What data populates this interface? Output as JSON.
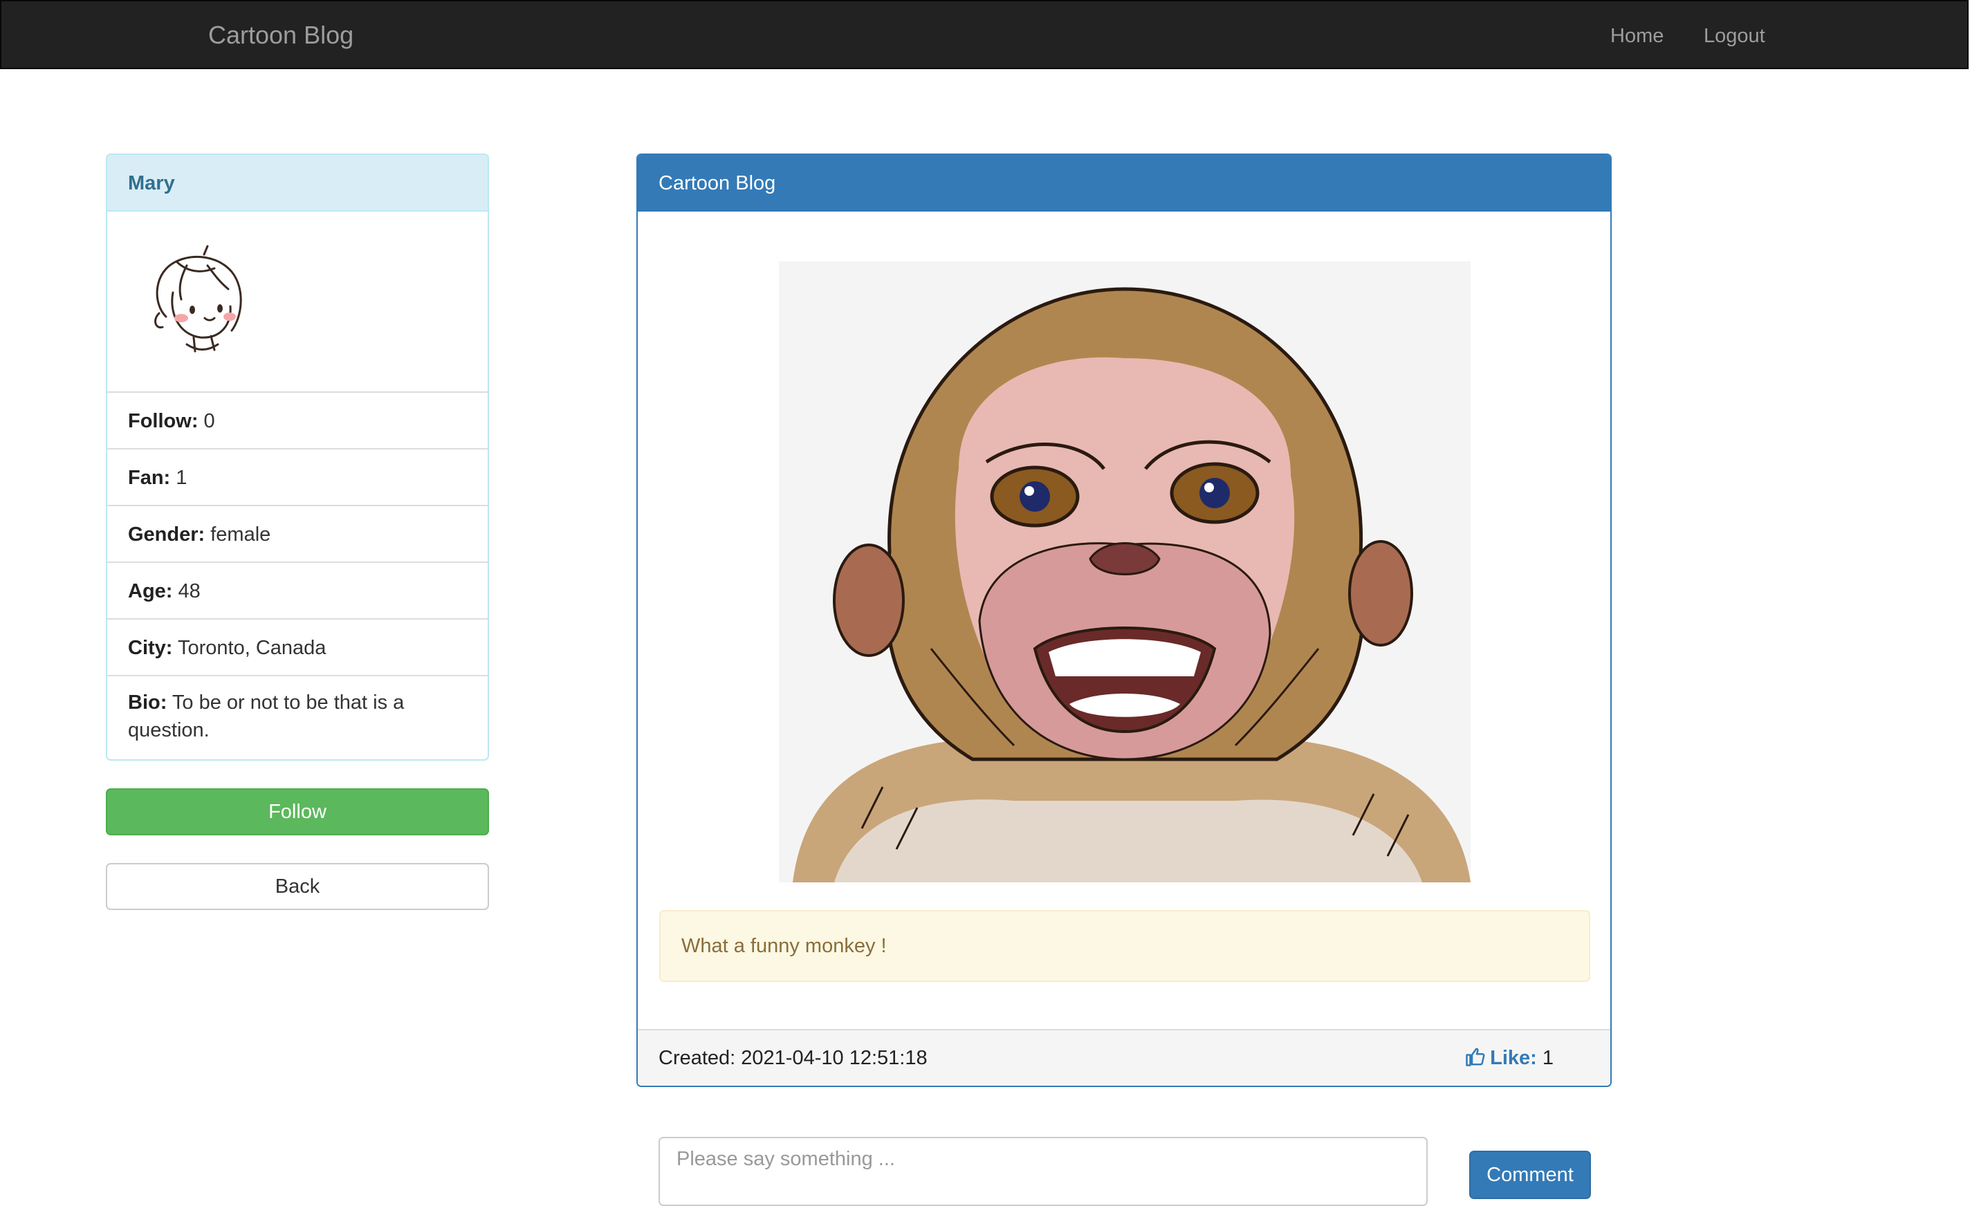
{
  "navbar": {
    "brand": "Cartoon Blog",
    "links": {
      "home": "Home",
      "logout": "Logout"
    }
  },
  "profile": {
    "name": "Mary",
    "avatar_icon": "girl-avatar-icon",
    "fields": {
      "follow": {
        "label": "Follow:",
        "value": "0"
      },
      "fan": {
        "label": "Fan:",
        "value": "1"
      },
      "gender": {
        "label": "Gender:",
        "value": "female"
      },
      "age": {
        "label": "Age:",
        "value": "48"
      },
      "city": {
        "label": "City:",
        "value": "Toronto, Canada"
      },
      "bio": {
        "label": "Bio:",
        "value": "To be or not to be that is a question."
      }
    },
    "follow_button": "Follow",
    "back_button": "Back"
  },
  "post": {
    "heading": "Cartoon Blog",
    "image_icon": "cartoon-monkey-image",
    "caption": "What a funny monkey !",
    "created_label": "Created:",
    "created_value": "2021-04-10 12:51:18",
    "like_icon": "thumbs-up-icon",
    "like_label": "Like:",
    "like_value": "1"
  },
  "comment": {
    "placeholder": "Please say something ...",
    "button": "Comment"
  },
  "colors": {
    "navbar_bg": "#222222",
    "primary": "#337ab7",
    "success": "#5cb85c",
    "info_bg": "#d9edf7",
    "warning_bg": "#fcf8e3"
  }
}
